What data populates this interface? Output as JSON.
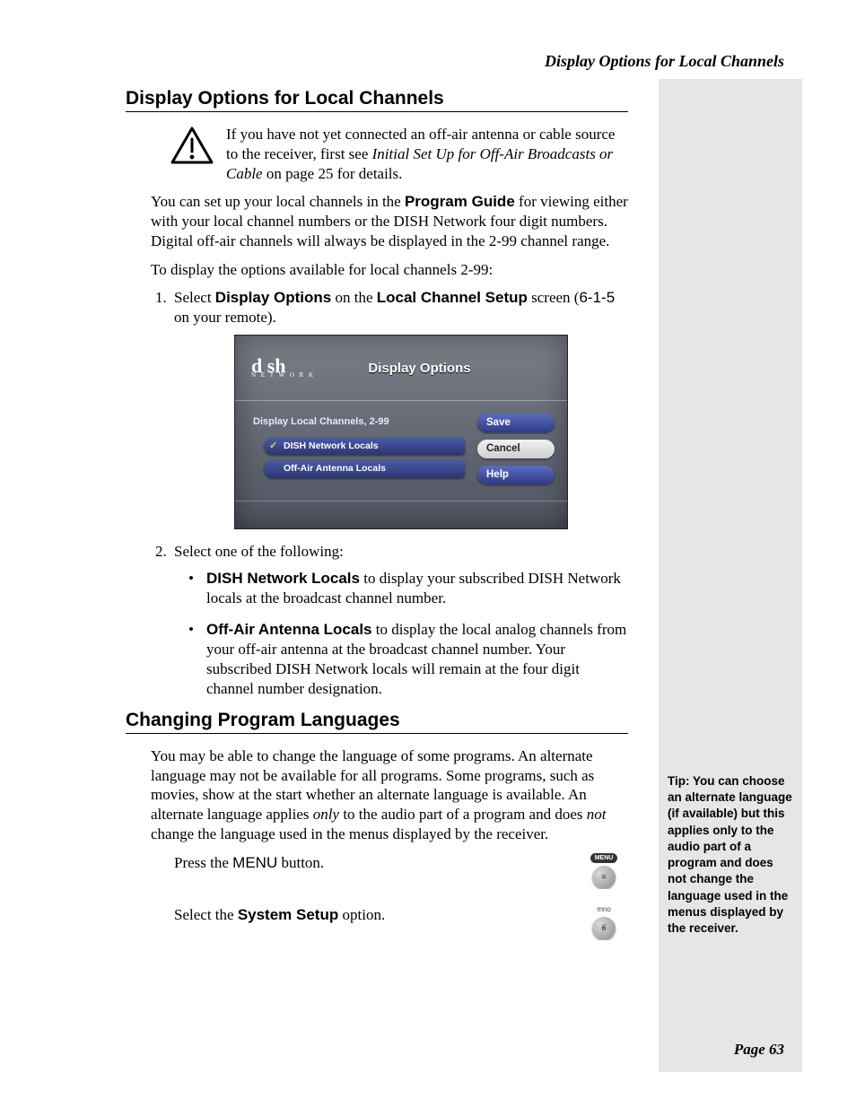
{
  "header": {
    "running_title": "Display Options for Local Channels"
  },
  "section1": {
    "title": "Display Options for Local Channels",
    "warning_pre": "If you have not yet connected an off-air antenna or cable source to the receiver, first see ",
    "warning_ital": "Initial Set Up for Off-Air Broadcasts or Cable",
    "warning_post": " on page 25 for details.",
    "intro_p1a": "You can set up your local channels in the ",
    "intro_p1_bold": "Program Guide",
    "intro_p1b": " for viewing either with your local channel numbers or the DISH Network four digit numbers. Digital off-air channels will always be displayed in the 2-99 channel range.",
    "intro_p2": "To display the options available for local channels 2-99:",
    "step1_a": "Select ",
    "step1_b": "Display Options",
    "step1_c": " on the ",
    "step1_d": "Local Channel Setup",
    "step1_e": " screen (",
    "step1_f": "6-1-5",
    "step1_g": " on your remote).",
    "step2": "Select one of the following:",
    "bullet1_b": "DISH Network Locals",
    "bullet1_t": " to display your subscribed DISH Network locals at the broadcast channel number.",
    "bullet2_b": "Off-Air Antenna Locals",
    "bullet2_t": " to display the local analog channels from your off-air antenna at the broadcast channel number. Your subscribed DISH Network locals will remain at the four digit channel number designation."
  },
  "screenshot": {
    "logo_main": "d sh",
    "logo_sub": "N E T W O R K",
    "title": "Display Options",
    "left_label": "Display Local Channels, 2-99",
    "opt1": "DISH Network Locals",
    "opt2": "Off-Air Antenna Locals",
    "btn_save": "Save",
    "btn_cancel": "Cancel",
    "btn_help": "Help"
  },
  "section2": {
    "title": "Changing Program Languages",
    "p1a": "You may be able to change the language of some programs. An alternate language may not be available for all programs. Some programs, such as movies, show at the start whether an alternate language is available. An alternate language applies ",
    "p1_only": "only",
    "p1b": " to the audio part of a program and does ",
    "p1_not": "not",
    "p1c": " change the language used in the menus displayed by the receiver.",
    "step1_a": "Press the ",
    "step1_b": "MENU",
    "step1_c": " button.",
    "step2_a": "Select the ",
    "step2_b": "System Setup",
    "step2_c": " option.",
    "remote1_label": "MENU",
    "remote1_glyph": "≡",
    "remote2_label": "mno",
    "remote2_glyph": "6"
  },
  "sidebar": {
    "tip": "Tip: You can choose an alternate language (if available) but this applies only to the audio part of a program and does not change the language used in the menus displayed by the receiver."
  },
  "footer": {
    "page": "Page 63"
  }
}
